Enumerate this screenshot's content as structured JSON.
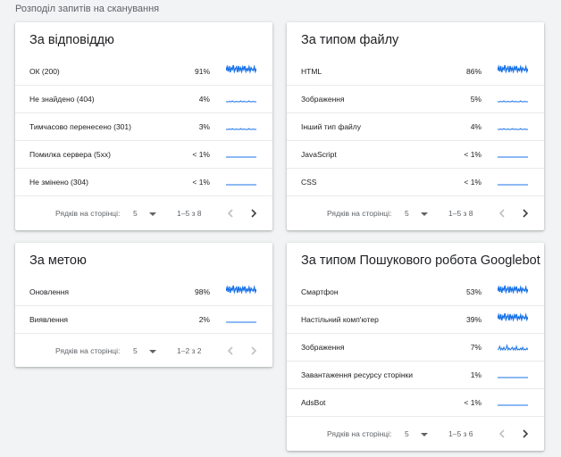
{
  "page": {
    "title": "Розподіл запитів на сканування"
  },
  "colors": {
    "accent": "#1a73e8",
    "disabled": "#bdc1c6",
    "enabled": "#5f6368"
  },
  "cards": [
    {
      "title": "За відповіддю",
      "rows": [
        {
          "label": "ОК (200)",
          "value": "91%",
          "trend": "dense"
        },
        {
          "label": "Не знайдено (404)",
          "value": "4%",
          "trend": "low"
        },
        {
          "label": "Тимчасово перенесено (301)",
          "value": "3%",
          "trend": "low"
        },
        {
          "label": "Помилка сервера (5xx)",
          "value": "< 1%",
          "trend": "flat"
        },
        {
          "label": "Не змінено (304)",
          "value": "< 1%",
          "trend": "flat"
        }
      ],
      "footer": {
        "per_page_label": "Рядків на сторінці:",
        "per_page_value": "5",
        "range": "1–5 з 8",
        "prev_enabled": false,
        "next_enabled": true
      }
    },
    {
      "title": "За типом файлу",
      "rows": [
        {
          "label": "HTML",
          "value": "86%",
          "trend": "dense"
        },
        {
          "label": "Зображення",
          "value": "5%",
          "trend": "low"
        },
        {
          "label": "Інший тип файлу",
          "value": "4%",
          "trend": "low"
        },
        {
          "label": "JavaScript",
          "value": "< 1%",
          "trend": "flat"
        },
        {
          "label": "CSS",
          "value": "< 1%",
          "trend": "flat"
        }
      ],
      "footer": {
        "per_page_label": "Рядків на сторінці:",
        "per_page_value": "5",
        "range": "1–5 з 8",
        "prev_enabled": false,
        "next_enabled": true
      }
    },
    {
      "title": "За метою",
      "rows": [
        {
          "label": "Оновлення",
          "value": "98%",
          "trend": "dense"
        },
        {
          "label": "Виявлення",
          "value": "2%",
          "trend": "flat"
        }
      ],
      "footer": {
        "per_page_label": "Рядків на сторінці:",
        "per_page_value": "5",
        "range": "1–2 з 2",
        "prev_enabled": false,
        "next_enabled": false
      }
    },
    {
      "title": "За типом Пошукового робота Googlebot",
      "rows": [
        {
          "label": "Смартфон",
          "value": "53%",
          "trend": "dense"
        },
        {
          "label": "Настільний комп'ютер",
          "value": "39%",
          "trend": "dense"
        },
        {
          "label": "Зображення",
          "value": "7%",
          "trend": "medium"
        },
        {
          "label": "Завантаження ресурсу сторінки",
          "value": "1%",
          "trend": "flat"
        },
        {
          "label": "AdsBot",
          "value": "< 1%",
          "trend": "flat"
        }
      ],
      "footer": {
        "per_page_label": "Рядків на сторінці:",
        "per_page_value": "5",
        "range": "1–5 з 6",
        "prev_enabled": false,
        "next_enabled": true
      }
    }
  ]
}
